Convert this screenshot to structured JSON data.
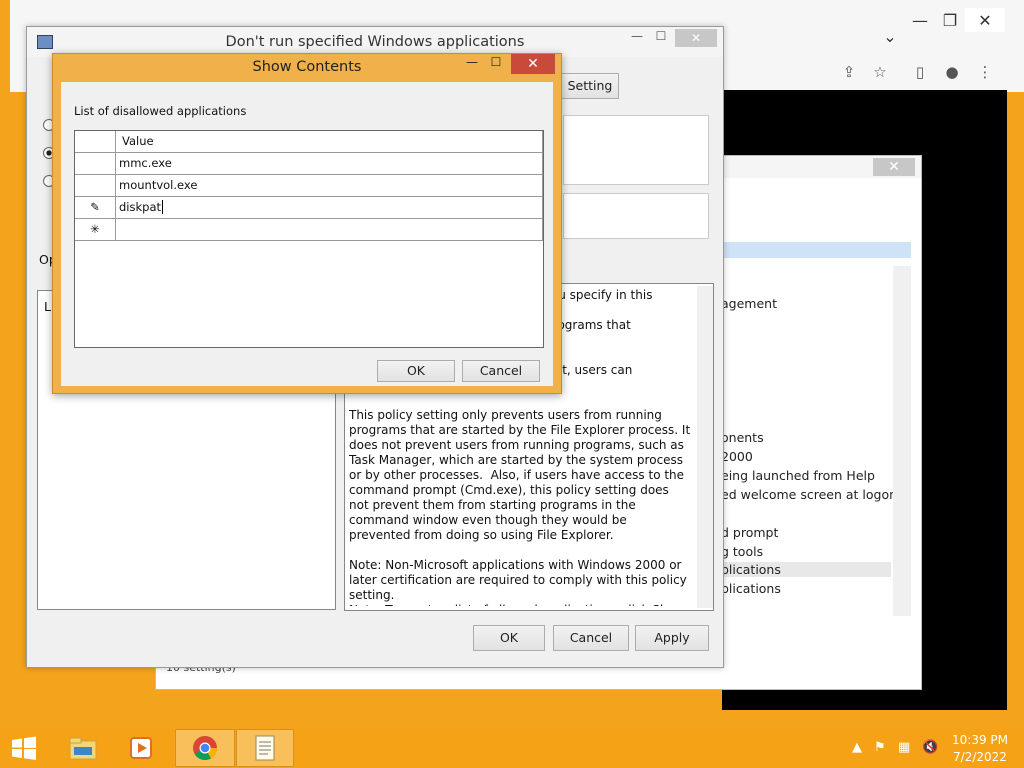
{
  "chrome": {
    "controls": {
      "minimize": "—",
      "restore": "❐",
      "close": "✕"
    },
    "dropdown": "⌄",
    "toolbar_icons": [
      "share-icon",
      "star-icon",
      "sidebar-icon",
      "profile-icon",
      "menu-icon"
    ]
  },
  "gpedit": {
    "tree_items": [
      "agement",
      "onents",
      "2000",
      "eing launched from Help",
      "ed welcome screen at logon",
      "d prompt",
      "g tools",
      "plications",
      "plications"
    ],
    "status": "10 setting(s)",
    "close": "✕"
  },
  "policy_dialog": {
    "title": "Don't run specified Windows applications",
    "setting_button": "Setting",
    "options_label": "Op",
    "options_inner": "Li",
    "help_text": "                                     rograms you specify in this\n\n                                     nnot run programs that\n                                     ions.\n\n                                     t configure it, users can\nrun any programs.\n\nThis policy setting only prevents users from running programs that are started by the File Explorer process. It does not prevent users from running programs, such as Task Manager, which are started by the system process or by other processes.  Also, if users have access to the command prompt (Cmd.exe), this policy setting does not prevent them from starting programs in the command window even though they would be prevented from doing so using File Explorer.\n\nNote: Non-Microsoft applications with Windows 2000 or later certification are required to comply with this policy setting.\nNote: To create a list of allowed applications, click Show.  In the",
    "ok": "OK",
    "cancel": "Cancel",
    "apply": "Apply"
  },
  "show_contents": {
    "title": "Show Contents",
    "list_label": "List of disallowed applications",
    "column_header": "Value",
    "rows": [
      {
        "marker": "",
        "value": "mmc.exe"
      },
      {
        "marker": "",
        "value": "mountvol.exe"
      },
      {
        "marker": "✎",
        "value": "diskpat"
      },
      {
        "marker": "✳",
        "value": ""
      }
    ],
    "ok": "OK",
    "cancel": "Cancel",
    "close": "✕",
    "minimize": "—",
    "maximize": "☐"
  },
  "taskbar": {
    "apps": [
      "file-explorer-icon",
      "media-player-icon",
      "chrome-icon",
      "notepad-icon"
    ],
    "time": "10:39 PM",
    "date": "7/2/2022"
  }
}
